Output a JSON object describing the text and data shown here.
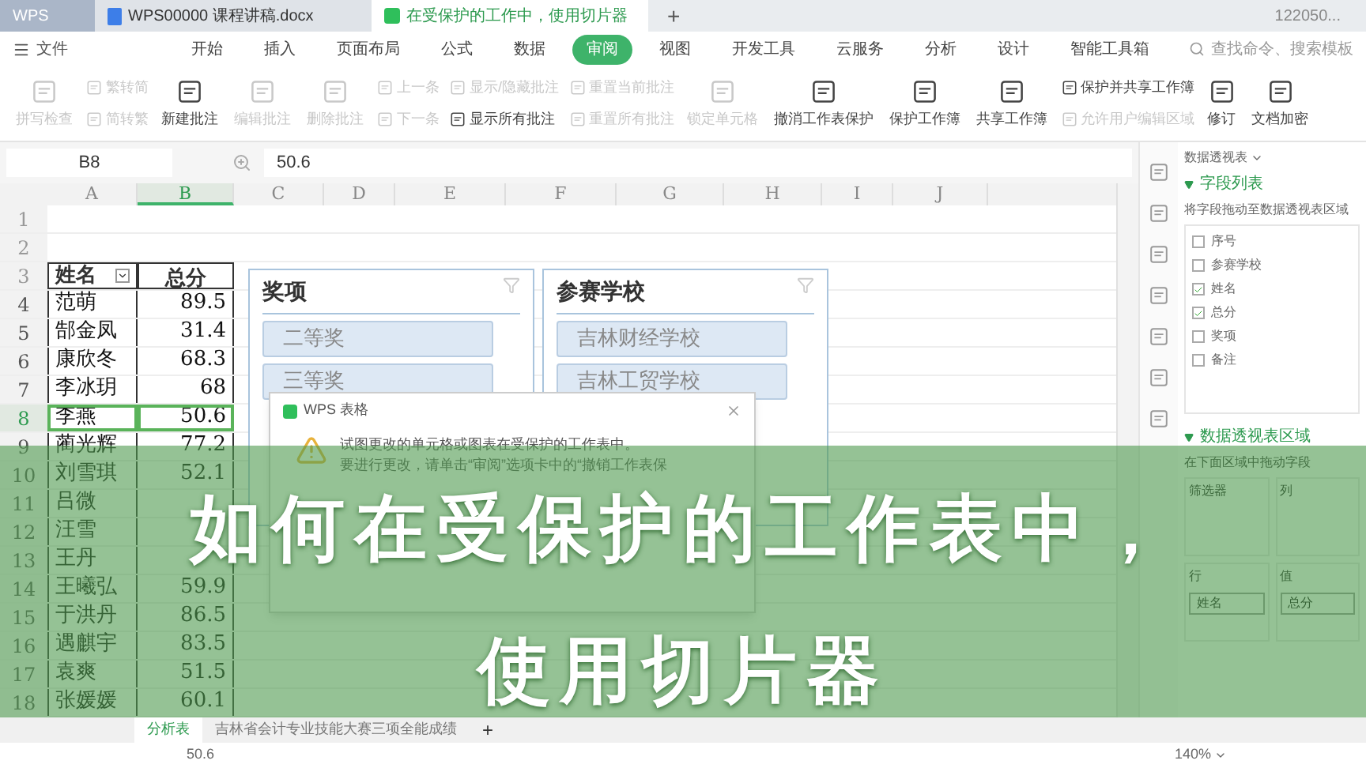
{
  "title_bar": {
    "tabs": [
      {
        "label": "WPS",
        "kind": "home",
        "selected": false
      },
      {
        "label": "WPS00000 课程讲稿.docx",
        "kind": "doc",
        "selected": false
      },
      {
        "label": "在受保护的工作中，使用切片器",
        "kind": "sheet",
        "selected": true
      }
    ],
    "new_tab": "+",
    "user": "122050..."
  },
  "menu": {
    "file": "文件",
    "tabs": [
      {
        "label": "开始",
        "selected": false
      },
      {
        "label": "插入",
        "selected": false
      },
      {
        "label": "页面布局",
        "selected": false
      },
      {
        "label": "公式",
        "selected": false
      },
      {
        "label": "数据",
        "selected": false
      },
      {
        "label": "审阅",
        "selected": true
      },
      {
        "label": "视图",
        "selected": false
      },
      {
        "label": "开发工具",
        "selected": false
      },
      {
        "label": "云服务",
        "selected": false
      },
      {
        "label": "分析",
        "selected": false
      },
      {
        "label": "设计",
        "selected": false
      },
      {
        "label": "智能工具箱",
        "selected": false
      }
    ],
    "search": {
      "placeholder": "查找命令、搜索模板"
    }
  },
  "ribbon": [
    {
      "kind": "large",
      "label": "拼写检查",
      "disabled": true
    },
    {
      "kind": "stack",
      "items": [
        {
          "label": "繁转简",
          "disabled": true
        },
        {
          "label": "简转繁",
          "disabled": true
        }
      ]
    },
    {
      "kind": "large",
      "label": "新建批注",
      "disabled": false
    },
    {
      "kind": "large",
      "label": "编辑批注",
      "disabled": true
    },
    {
      "kind": "large",
      "label": "删除批注",
      "disabled": true
    },
    {
      "kind": "stack",
      "items": [
        {
          "label": "上一条",
          "disabled": true
        },
        {
          "label": "下一条",
          "disabled": true
        }
      ]
    },
    {
      "kind": "stack",
      "items": [
        {
          "label": "显示/隐藏批注",
          "disabled": true
        },
        {
          "label": "显示所有批注",
          "disabled": false
        }
      ]
    },
    {
      "kind": "stack",
      "items": [
        {
          "label": "重置当前批注",
          "disabled": true
        },
        {
          "label": "重置所有批注",
          "disabled": true
        }
      ]
    },
    {
      "kind": "large",
      "label": "锁定单元格",
      "disabled": true
    },
    {
      "kind": "large",
      "label": "撤消工作表保护",
      "disabled": false
    },
    {
      "kind": "large",
      "label": "保护工作簿",
      "disabled": false
    },
    {
      "kind": "large",
      "label": "共享工作簿",
      "disabled": false
    },
    {
      "kind": "stack",
      "items": [
        {
          "label": "保护并共享工作簿",
          "disabled": false
        },
        {
          "label": "允许用户编辑区域",
          "disabled": true
        }
      ]
    },
    {
      "kind": "large",
      "label": "修订",
      "disabled": false
    },
    {
      "kind": "large",
      "label": "文档加密",
      "disabled": false
    }
  ],
  "formula_bar": {
    "name_box": "B8",
    "value": "50.6"
  },
  "sheet": {
    "columns": [
      {
        "label": "A",
        "selected": false
      },
      {
        "label": "B",
        "selected": true
      },
      {
        "label": "C",
        "selected": false
      },
      {
        "label": "D",
        "selected": false
      },
      {
        "label": "E",
        "selected": false
      },
      {
        "label": "F",
        "selected": false
      },
      {
        "label": "G",
        "selected": false
      },
      {
        "label": "H",
        "selected": false
      },
      {
        "label": "I",
        "selected": false
      },
      {
        "label": "J",
        "selected": false
      }
    ],
    "empty_rows": [
      "1",
      "2"
    ],
    "header_row": {
      "number": "3",
      "cells": [
        "姓名",
        "总分"
      ]
    },
    "rows": [
      {
        "number": "4",
        "name": "范萌",
        "score": "89.5",
        "selected": false
      },
      {
        "number": "5",
        "name": "郜金凤",
        "score": "31.4",
        "selected": false
      },
      {
        "number": "6",
        "name": "康欣冬",
        "score": "68.3",
        "selected": false
      },
      {
        "number": "7",
        "name": "李冰玥",
        "score": "68",
        "selected": false
      },
      {
        "number": "8",
        "name": "李燕",
        "score": "50.6",
        "selected": true
      },
      {
        "number": "9",
        "name": "蔺光辉",
        "score": "77.2",
        "selected": false
      },
      {
        "number": "10",
        "name": "刘雪琪",
        "score": "52.1",
        "selected": false
      },
      {
        "number": "11",
        "name": "吕微",
        "selected": false
      },
      {
        "number": "12",
        "name": "汪雪",
        "selected": false
      },
      {
        "number": "13",
        "name": "王丹",
        "selected": false
      },
      {
        "number": "14",
        "name": "王曦弘",
        "score": "59.9",
        "selected": false
      },
      {
        "number": "15",
        "name": "于洪丹",
        "score": "86.5",
        "selected": false
      },
      {
        "number": "16",
        "name": "遇麒宇",
        "score": "83.5",
        "selected": false
      },
      {
        "number": "17",
        "name": "袁爽",
        "score": "51.5",
        "selected": false
      },
      {
        "number": "18",
        "name": "张媛媛",
        "score": "60.1",
        "selected": false
      }
    ]
  },
  "slicers": [
    {
      "title": "奖项",
      "items": [
        "二等奖",
        "三等奖"
      ]
    },
    {
      "title": "参赛学校",
      "items": [
        "吉林财经学校",
        "吉林工贸学校"
      ]
    }
  ],
  "dialog": {
    "title": "WPS 表格",
    "lines": [
      "试图更改的单元格或图表在受保护的工作表中。",
      "要进行更改，请单击“审阅”选项卡中的“撤销工作表保"
    ]
  },
  "pivot_panel": {
    "title": "数据透视表",
    "field_section": "字段列表",
    "field_hint": "将字段拖动至数据透视表区域",
    "fields": [
      {
        "label": "序号",
        "checked": false
      },
      {
        "label": "参赛学校",
        "checked": false
      },
      {
        "label": "姓名",
        "checked": true
      },
      {
        "label": "总分",
        "checked": true
      },
      {
        "label": "奖项",
        "checked": false
      },
      {
        "label": "备注",
        "checked": false
      }
    ],
    "area_section": "数据透视表区域",
    "area_hint": "在下面区域中拖动字段",
    "areas": [
      {
        "label": "筛选器"
      },
      {
        "label": "列"
      },
      {
        "label": "行",
        "value": "姓名"
      },
      {
        "label": "值",
        "value": "总分"
      }
    ]
  },
  "sheet_tabs": [
    {
      "label": "分析表",
      "selected": true
    },
    {
      "label": "吉林省会计专业技能大赛三项全能成绩",
      "selected": false
    }
  ],
  "add_sheet": "+",
  "status_bar": {
    "value": "50.6",
    "zoom": "140%"
  },
  "banner": {
    "lines": [
      "如何在受保护的工作表中，",
      "使用切片器"
    ]
  }
}
